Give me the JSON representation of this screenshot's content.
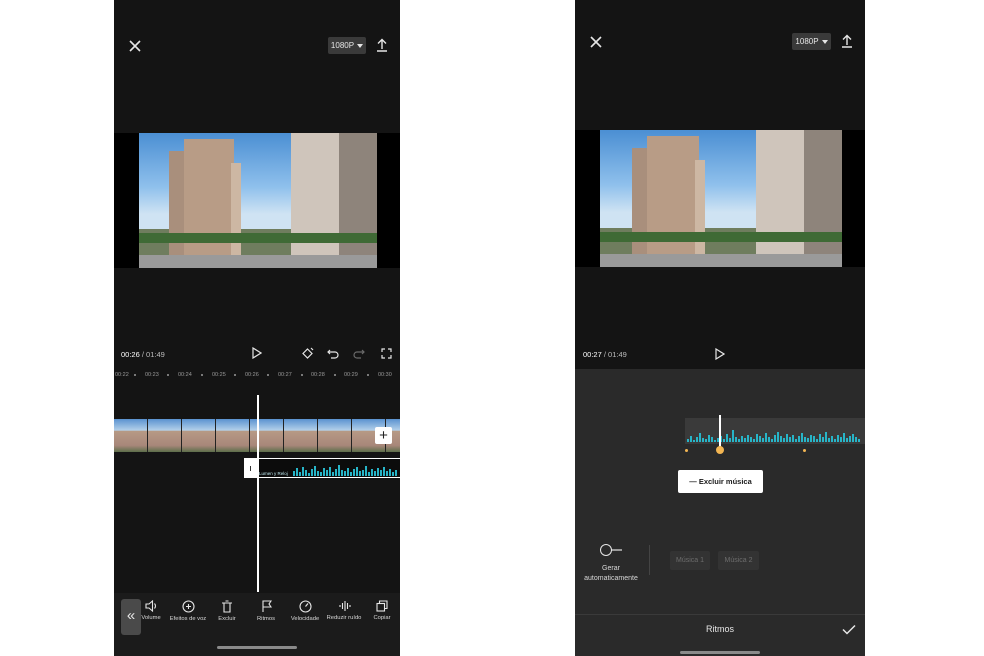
{
  "left": {
    "resolution": "1080P",
    "time_current": "00:26",
    "time_total": " / 01:49",
    "ruler_ticks": [
      "00:22",
      "00:23",
      "00:24",
      "00:25",
      "00:26",
      "00:27",
      "00:28",
      "00:29",
      "00:30"
    ],
    "audio_clip_label": "Lumen y Reloj",
    "add_button": "+",
    "collapse_button": "«",
    "toolbar": [
      {
        "label": "Volume",
        "icon": "volume-icon"
      },
      {
        "label": "Efeitos de voz",
        "icon": "voice-effects-icon"
      },
      {
        "label": "Excluir",
        "icon": "trash-icon"
      },
      {
        "label": "Ritmos",
        "icon": "flag-icon"
      },
      {
        "label": "Velocidade",
        "icon": "speed-icon"
      },
      {
        "label": "Reduzir ruído",
        "icon": "noise-reduction-icon"
      },
      {
        "label": "Copiar",
        "icon": "copy-icon"
      }
    ]
  },
  "right": {
    "resolution": "1080P",
    "time_current": "00:27",
    "time_total": " / 01:49",
    "delete_music": "— Excluir música",
    "auto_generate_line1": "Gerar",
    "auto_generate_line2": "automaticamente",
    "music_options": [
      "Música 1",
      "Música 2"
    ],
    "panel_title": "Ritmos"
  },
  "colors": {
    "accent": "#27b5c8",
    "beat_marker": "#f2b552",
    "background": "#141414",
    "panel": "#2a2a2a"
  }
}
